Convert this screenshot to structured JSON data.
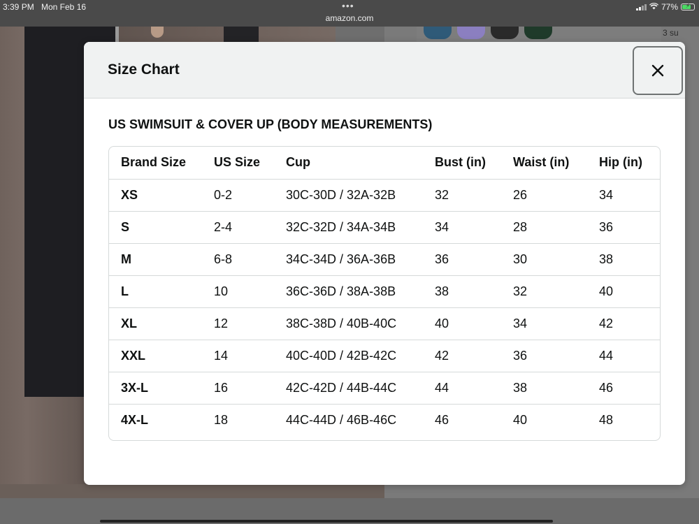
{
  "status_bar": {
    "time": "3:39 PM",
    "date": "Mon Feb 16",
    "url": "amazon.com",
    "battery": "77%",
    "battery_level": 0.77
  },
  "background": {
    "side_note": "3 su"
  },
  "modal": {
    "title": "Size Chart",
    "section_title": "US SWIMSUIT & COVER UP (BODY MEASUREMENTS)",
    "table": {
      "headers": [
        "Brand Size",
        "US Size",
        "Cup",
        "Bust (in)",
        "Waist (in)",
        "Hip (in)"
      ],
      "rows": [
        [
          "XS",
          "0-2",
          "30C-30D / 32A-32B",
          "32",
          "26",
          "34"
        ],
        [
          "S",
          "2-4",
          "32C-32D / 34A-34B",
          "34",
          "28",
          "36"
        ],
        [
          "M",
          "6-8",
          "34C-34D / 36A-36B",
          "36",
          "30",
          "38"
        ],
        [
          "L",
          "10",
          "36C-36D / 38A-38B",
          "38",
          "32",
          "40"
        ],
        [
          "XL",
          "12",
          "38C-38D / 40B-40C",
          "40",
          "34",
          "42"
        ],
        [
          "XXL",
          "14",
          "40C-40D / 42B-42C",
          "42",
          "36",
          "44"
        ],
        [
          "3X-L",
          "16",
          "42C-42D / 44B-44C",
          "44",
          "38",
          "46"
        ],
        [
          "4X-L",
          "18",
          "44C-44D / 46B-46C",
          "46",
          "40",
          "48"
        ]
      ]
    }
  },
  "colors": {
    "header_bg": "#f0f2f2",
    "border": "#d5d9d9",
    "text": "#0f1111",
    "battery": "#4cd964"
  }
}
